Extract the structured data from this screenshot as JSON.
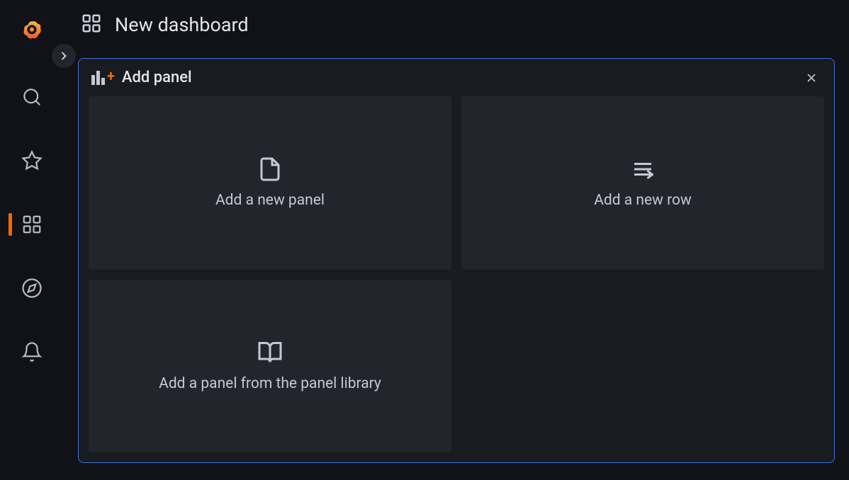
{
  "header": {
    "title": "New dashboard"
  },
  "panel": {
    "title": "Add panel",
    "options": [
      {
        "label": "Add a new panel"
      },
      {
        "label": "Add a new row"
      },
      {
        "label": "Add a panel from the panel library"
      }
    ]
  }
}
